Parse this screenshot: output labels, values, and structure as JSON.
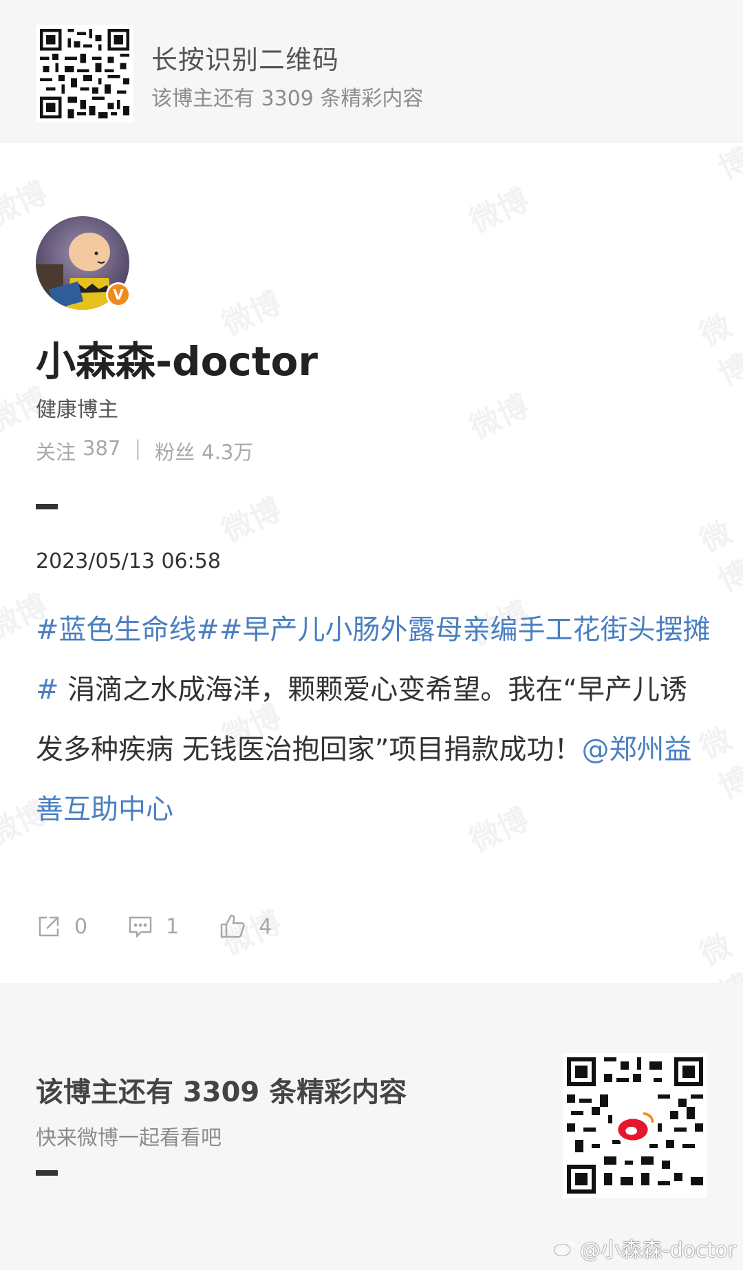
{
  "top_banner": {
    "line1": "长按识别二维码",
    "line2": "该博主还有 3309 条精彩内容"
  },
  "profile": {
    "name": "小森森-doctor",
    "tag": "健康博主",
    "follow_label": "关注",
    "follow_count": "387",
    "separator": "|",
    "fans_label": "粉丝",
    "fans_count": "4.3万",
    "verify_mark": "V"
  },
  "post": {
    "time": "2023/05/13 06:58",
    "tag1": "#蓝色生命线#",
    "tag2": "#早产儿小肠外露母亲编手工花街头摆摊#",
    "text": " 涓滴之水成海洋，颗颗爱心变希望。我在“早产儿诱发多种疾病 无钱医治抱回家”项目捐款成功！",
    "mention": "@郑州益善互助中心"
  },
  "actions": {
    "repost_count": "0",
    "comment_count": "1",
    "like_count": "4"
  },
  "bottom": {
    "title": "该博主还有 3309 条精彩内容",
    "subtitle": "快来微博一起看看吧",
    "watermark": "@小森森-doctor"
  },
  "watermark_text": "微博",
  "colors": {
    "link": "#4a7fc1",
    "badge": "#f08a1c",
    "panel_bg": "#f6f6f6"
  },
  "icons": [
    "qr-code-icon",
    "verified-badge-icon",
    "repost-icon",
    "comment-icon",
    "like-icon",
    "weibo-logo-icon"
  ]
}
